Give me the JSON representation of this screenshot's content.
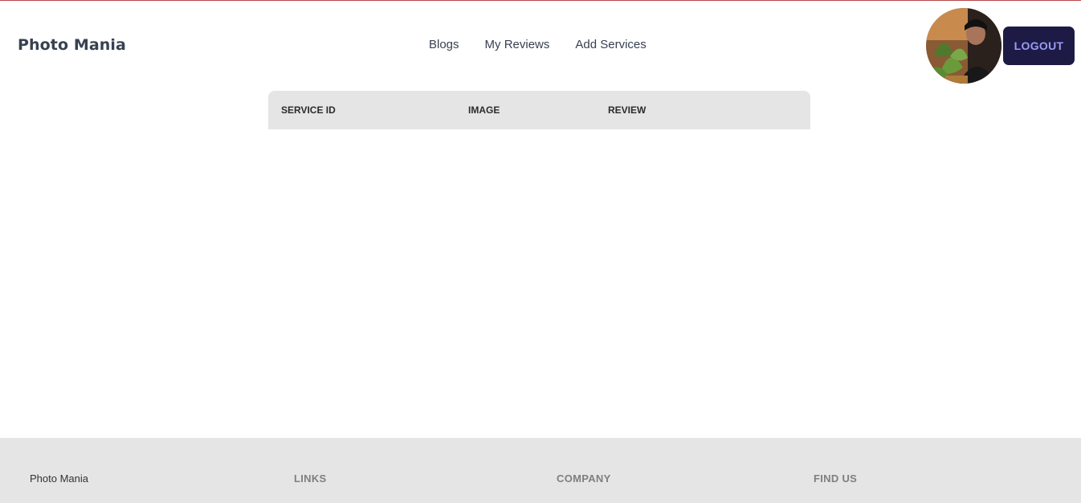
{
  "navbar": {
    "brand": "Photo Mania",
    "links": [
      "Blogs",
      "My Reviews",
      "Add Services"
    ],
    "logout_label": "LOGOUT"
  },
  "table": {
    "headers": [
      "SERVICE ID",
      "IMAGE",
      "REVIEW"
    ]
  },
  "footer": {
    "brand": "Photo Mania",
    "headings": [
      "LINKS",
      "COMPANY",
      "FIND US"
    ]
  },
  "colors": {
    "accent_button": "#1d1b45",
    "button_text": "#9b9af7",
    "table_header_bg": "#e5e5e5",
    "footer_bg": "#e5e5e5"
  }
}
